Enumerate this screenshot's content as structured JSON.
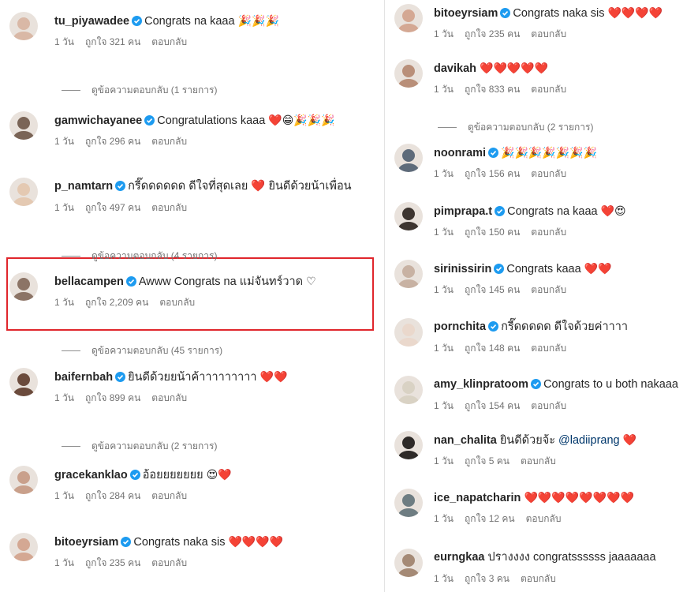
{
  "left": [
    {
      "user": "tu_piyawadee",
      "verified": true,
      "text": "Congrats na kaaa",
      "emoji": "🎉🎉🎉",
      "time": "1 วัน",
      "likes": "ถูกใจ 321 คน",
      "reply": "ตอบกลับ",
      "view_replies": "ดูข้อความตอบกลับ (1 รายการ)",
      "avatar_color": "#d9b8a6"
    },
    {
      "user": "gamwichayanee",
      "verified": true,
      "text": "Congratulations kaaa",
      "emoji": "❤️😁🎉🎉🎉",
      "time": "1 วัน",
      "likes": "ถูกใจ 296 คน",
      "reply": "ตอบกลับ",
      "avatar_color": "#7a6456"
    },
    {
      "user": "p_namtarn",
      "verified": true,
      "text": "กรี๊ดดดดดด ดีใจที่สุดเลย ❤️ ยินดีด้วยน้าเพื่อน",
      "emoji": "",
      "time": "1 วัน",
      "likes": "ถูกใจ 497 คน",
      "reply": "ตอบกลับ",
      "view_replies": "ดูข้อความตอบกลับ (4 รายการ)",
      "avatar_color": "#e4c9b2"
    },
    {
      "user": "bellacampen",
      "verified": true,
      "text": "Awww Congrats na แม่จันทร์วาด",
      "emoji": "♡",
      "time": "1 วัน",
      "likes": "ถูกใจ 2,209 คน",
      "reply": "ตอบกลับ",
      "view_replies": "ดูข้อความตอบกลับ (45 รายการ)",
      "avatar_color": "#8c7466"
    },
    {
      "user": "baifernbah",
      "verified": true,
      "text": "ยินดีด้วยยน้าค้าาาาาาาาา",
      "emoji": "❤️❤️",
      "time": "1 วัน",
      "likes": "ถูกใจ 899 คน",
      "reply": "ตอบกลับ",
      "view_replies": "ดูข้อความตอบกลับ (2 รายการ)",
      "avatar_color": "#6b4b3c"
    },
    {
      "user": "gracekanklao",
      "verified": true,
      "text": "อ้อยยยยยยย",
      "emoji": "😍❤️",
      "time": "1 วัน",
      "likes": "ถูกใจ 284 คน",
      "reply": "ตอบกลับ",
      "avatar_color": "#c9a08b"
    },
    {
      "user": "bitoeyrsiam",
      "verified": true,
      "text": "Congrats naka sis",
      "emoji": "❤️❤️❤️❤️",
      "time": "1 วัน",
      "likes": "ถูกใจ 235 คน",
      "reply": "ตอบกลับ",
      "avatar_color": "#d4a893"
    }
  ],
  "right": [
    {
      "user": "bitoeyrsiam",
      "verified": true,
      "text": "Congrats naka sis",
      "emoji": "❤️❤️❤️❤️",
      "time": "1 วัน",
      "likes": "ถูกใจ 235 คน",
      "reply": "ตอบกลับ",
      "avatar_color": "#d4a893"
    },
    {
      "user": "davikah",
      "verified": false,
      "text": "",
      "emoji": "❤️❤️❤️❤️❤️",
      "time": "1 วัน",
      "likes": "ถูกใจ 833 คน",
      "reply": "ตอบกลับ",
      "view_replies": "ดูข้อความตอบกลับ (2 รายการ)",
      "avatar_color": "#b98f79"
    },
    {
      "user": "noonrami",
      "verified": true,
      "text": "",
      "emoji": "🎉🎉🎉🎉🎉🎉🎉",
      "time": "1 วัน",
      "likes": "ถูกใจ 156 คน",
      "reply": "ตอบกลับ",
      "avatar_color": "#5e6b7a"
    },
    {
      "user": "pimprapa.t",
      "verified": true,
      "text": "Congrats na kaaa",
      "emoji": "❤️😍",
      "time": "1 วัน",
      "likes": "ถูกใจ 150 คน",
      "reply": "ตอบกลับ",
      "avatar_color": "#3d3530"
    },
    {
      "user": "sirinissirin",
      "verified": true,
      "text": "Congrats kaaa",
      "emoji": "❤️❤️",
      "time": "1 วัน",
      "likes": "ถูกใจ 145 คน",
      "reply": "ตอบกลับ",
      "avatar_color": "#c8b2a3"
    },
    {
      "user": "pornchita",
      "verified": true,
      "text": "กรี๊ดดดดด ดีใจด้วยค่าาาา",
      "emoji": "",
      "time": "1 วัน",
      "likes": "ถูกใจ 148 คน",
      "reply": "ตอบกลับ",
      "avatar_color": "#ead8cc"
    },
    {
      "user": "amy_klinpratoom",
      "verified": true,
      "text": "Congrats to u both nakaaa",
      "emoji": "",
      "time": "1 วัน",
      "likes": "ถูกใจ 154 คน",
      "reply": "ตอบกลับ",
      "avatar_color": "#d9d2c4"
    },
    {
      "user": "nan_chalita",
      "verified": false,
      "text": "ยินดีด้วยจ้ะ",
      "mention": "@ladiiprang",
      "emoji": "❤️",
      "time": "1 วัน",
      "likes": "ถูกใจ 5 คน",
      "reply": "ตอบกลับ",
      "avatar_color": "#2e2a28"
    },
    {
      "user": "ice_napatcharin",
      "verified": false,
      "text": "",
      "emoji": "❤️❤️❤️❤️❤️❤️❤️❤️",
      "time": "1 วัน",
      "likes": "ถูกใจ 12 คน",
      "reply": "ตอบกลับ",
      "avatar_color": "#6e7d82"
    },
    {
      "user": "eurngkaa",
      "verified": false,
      "text": "ปรางงงง congratssssss jaaaaaaa",
      "emoji": "",
      "time": "1 วัน",
      "likes": "ถูกใจ 3 คน",
      "reply": "ตอบกลับ",
      "avatar_color": "#a58a76"
    }
  ]
}
